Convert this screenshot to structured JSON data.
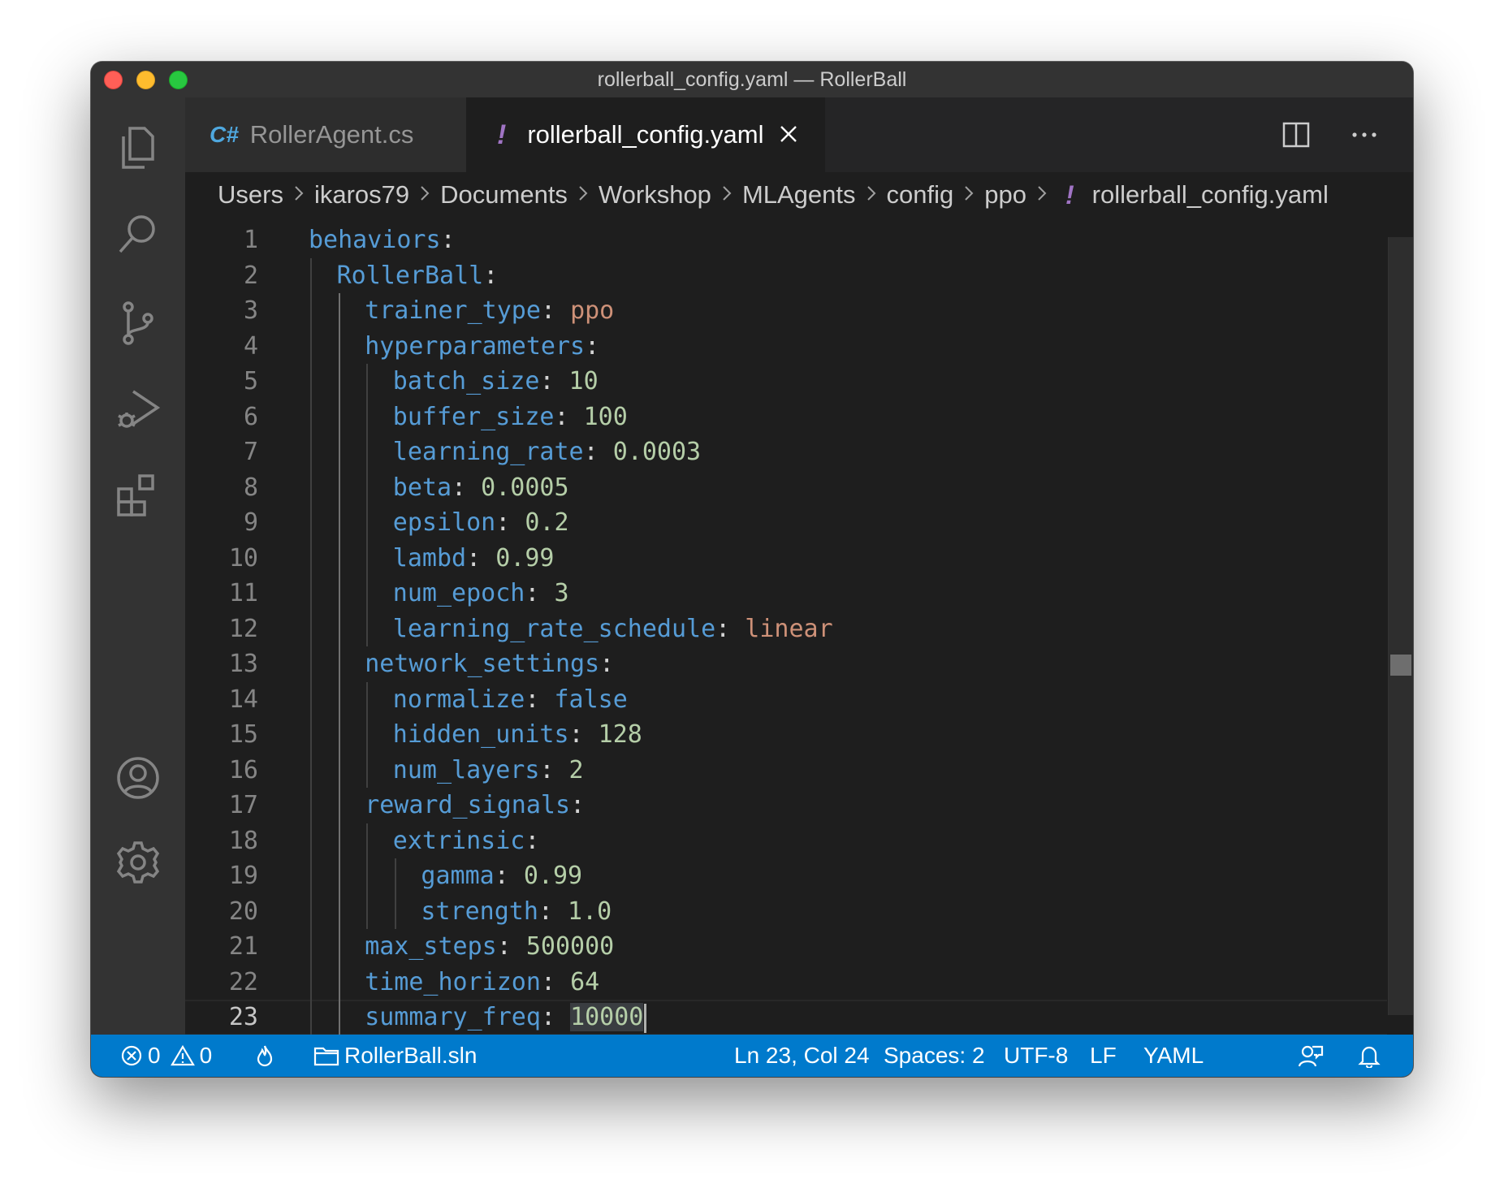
{
  "window": {
    "title": "rollerball_config.yaml — RollerBall"
  },
  "tabs": [
    {
      "label": "RollerAgent.cs",
      "icon": "csharp-file-icon",
      "glyph": "C#",
      "active": false
    },
    {
      "label": "rollerball_config.yaml",
      "icon": "yaml-file-icon",
      "glyph": "!",
      "active": true
    }
  ],
  "breadcrumbs": {
    "items": [
      "Users",
      "ikaros79",
      "Documents",
      "Workshop",
      "MLAgents",
      "config",
      "ppo"
    ],
    "file_glyph": "!",
    "file": "rollerball_config.yaml"
  },
  "editor": {
    "current_line": 23,
    "lines": [
      {
        "no": "1",
        "key": "behaviors",
        "value": "",
        "type": ""
      },
      {
        "no": "2",
        "key": "RollerBall",
        "value": "",
        "type": ""
      },
      {
        "no": "3",
        "key": "trainer_type",
        "value": "ppo",
        "type": "string"
      },
      {
        "no": "4",
        "key": "hyperparameters",
        "value": "",
        "type": ""
      },
      {
        "no": "5",
        "key": "batch_size",
        "value": "10",
        "type": "number"
      },
      {
        "no": "6",
        "key": "buffer_size",
        "value": "100",
        "type": "number"
      },
      {
        "no": "7",
        "key": "learning_rate",
        "value": "0.0003",
        "type": "number"
      },
      {
        "no": "8",
        "key": "beta",
        "value": "0.0005",
        "type": "number"
      },
      {
        "no": "9",
        "key": "epsilon",
        "value": "0.2",
        "type": "number"
      },
      {
        "no": "10",
        "key": "lambd",
        "value": "0.99",
        "type": "number"
      },
      {
        "no": "11",
        "key": "num_epoch",
        "value": "3",
        "type": "number"
      },
      {
        "no": "12",
        "key": "learning_rate_schedule",
        "value": "linear",
        "type": "string"
      },
      {
        "no": "13",
        "key": "network_settings",
        "value": "",
        "type": ""
      },
      {
        "no": "14",
        "key": "normalize",
        "value": "false",
        "type": "keyword"
      },
      {
        "no": "15",
        "key": "hidden_units",
        "value": "128",
        "type": "number"
      },
      {
        "no": "16",
        "key": "num_layers",
        "value": "2",
        "type": "number"
      },
      {
        "no": "17",
        "key": "reward_signals",
        "value": "",
        "type": ""
      },
      {
        "no": "18",
        "key": "extrinsic",
        "value": "",
        "type": ""
      },
      {
        "no": "19",
        "key": "gamma",
        "value": "0.99",
        "type": "number"
      },
      {
        "no": "20",
        "key": "strength",
        "value": "1.0",
        "type": "number"
      },
      {
        "no": "21",
        "key": "max_steps",
        "value": "500000",
        "type": "number"
      },
      {
        "no": "22",
        "key": "time_horizon",
        "value": "64",
        "type": "number"
      },
      {
        "no": "23",
        "key": "summary_freq",
        "value": "10000",
        "type": "number"
      }
    ]
  },
  "statusbar": {
    "errors": "0",
    "warnings": "0",
    "solution": "RollerBall.sln",
    "position": "Ln 23, Col 24",
    "spaces": "Spaces: 2",
    "encoding": "UTF-8",
    "eol": "LF",
    "language": "YAML"
  },
  "colors": {
    "accent": "#007acc",
    "key": "#569cd6",
    "string": "#ce9178",
    "number": "#b5cea8",
    "yaml_icon": "#a074c4",
    "csharp_icon": "#4fa8df"
  }
}
